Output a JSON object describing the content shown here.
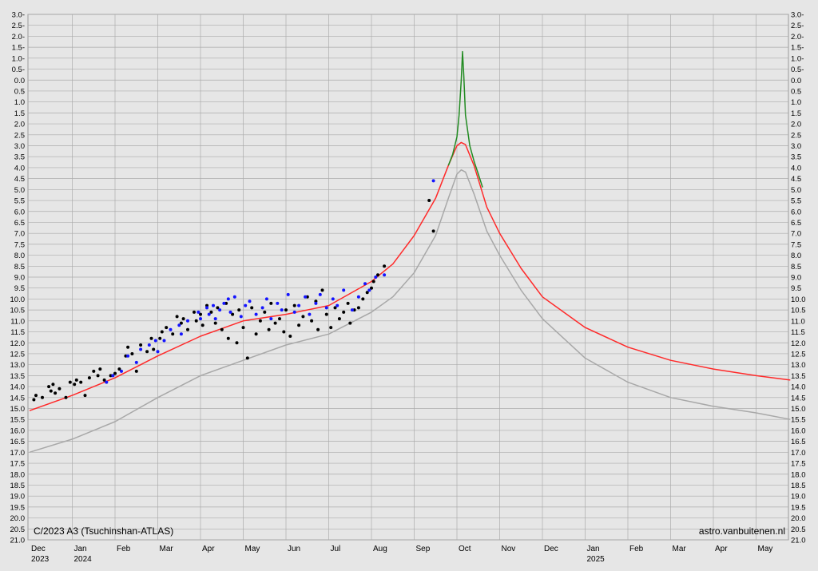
{
  "chart_data": {
    "type": "scatter",
    "title": "C/2023 A3 (Tsuchinshan-ATLAS)",
    "credit": "astro.vanbuitenen.nl",
    "x_axis": {
      "months": [
        "Dec",
        "Jan",
        "Feb",
        "Mar",
        "Apr",
        "May",
        "Jun",
        "Jul",
        "Aug",
        "Sep",
        "Oct",
        "Nov",
        "Dec",
        "Jan",
        "Feb",
        "Mar",
        "Apr",
        "May"
      ],
      "years": [
        {
          "label": "2023",
          "month_index": 0
        },
        {
          "label": "2024",
          "month_index": 1
        },
        {
          "label": "2025",
          "month_index": 13
        }
      ]
    },
    "y_axis": {
      "reversed": true,
      "ylim": [
        -3.0,
        21.0
      ],
      "tick_labels": [
        "3.0-",
        "2.5-",
        "2.0-",
        "1.5-",
        "1.0-",
        "0.5-",
        "0.0",
        "0.5",
        "1.0",
        "1.5",
        "2.0",
        "2.5",
        "3.0",
        "3.5",
        "4.0",
        "4.5",
        "5.0",
        "5.5",
        "6.0",
        "6.5",
        "7.0",
        "7.5",
        "8.0",
        "8.5",
        "9.0",
        "9.5",
        "10.0",
        "10.5",
        "11.0",
        "11.5",
        "12.0",
        "12.5",
        "13.0",
        "13.5",
        "14.0",
        "14.5",
        "15.0",
        "15.5",
        "16.0",
        "16.5",
        "17.0",
        "17.5",
        "18.0",
        "18.5",
        "19.0",
        "19.5",
        "20.0",
        "20.5",
        "21.0"
      ],
      "grid": true
    },
    "series": [
      {
        "kind": "line",
        "color": "#a8a8a8",
        "x": [
          0,
          1,
          2,
          3,
          4,
          5,
          6,
          7,
          8,
          8.5,
          9,
          9.5,
          9.8,
          10,
          10.1,
          10.2,
          10.4,
          10.7,
          11,
          11.5,
          12,
          13,
          14,
          15,
          16,
          17,
          17.8
        ],
        "y": [
          17.0,
          16.4,
          15.6,
          14.5,
          13.5,
          12.8,
          12.1,
          11.6,
          10.6,
          9.9,
          8.8,
          7.1,
          5.4,
          4.3,
          4.1,
          4.2,
          5.2,
          6.9,
          8.0,
          9.6,
          10.9,
          12.7,
          13.8,
          14.5,
          14.9,
          15.2,
          15.5
        ]
      },
      {
        "kind": "line",
        "color": "#ff2a2a",
        "x": [
          0,
          1,
          2,
          3,
          4,
          5,
          6,
          7,
          8,
          8.5,
          9,
          9.5,
          9.8,
          10,
          10.1,
          10.2,
          10.4,
          10.7,
          11,
          11.5,
          12,
          13,
          14,
          15,
          16,
          17,
          17.8
        ],
        "y": [
          15.1,
          14.4,
          13.6,
          12.6,
          11.7,
          11.0,
          10.7,
          10.3,
          9.2,
          8.4,
          7.1,
          5.4,
          3.9,
          3.0,
          2.85,
          2.95,
          3.9,
          5.8,
          7.0,
          8.6,
          9.9,
          11.3,
          12.2,
          12.8,
          13.2,
          13.5,
          13.7
        ]
      },
      {
        "kind": "line",
        "color": "#228b22",
        "x": [
          9.8,
          9.9,
          10.0,
          10.05,
          10.1,
          10.13,
          10.16,
          10.2,
          10.3,
          10.4,
          10.5,
          10.6
        ],
        "y": [
          3.9,
          3.4,
          2.6,
          1.6,
          0.0,
          -1.3,
          -0.2,
          1.6,
          3.0,
          3.7,
          4.3,
          4.9
        ]
      },
      {
        "kind": "points",
        "color": "#000000",
        "x": [
          0.1,
          0.15,
          0.3,
          0.45,
          0.5,
          0.55,
          0.6,
          0.7,
          0.85,
          0.95,
          1.05,
          1.1,
          1.2,
          1.3,
          1.4,
          1.5,
          1.6,
          1.65,
          1.75,
          1.9,
          2.0,
          2.1,
          2.25,
          2.3,
          2.4,
          2.5,
          2.6,
          2.75,
          2.85,
          2.9,
          3.05,
          3.1,
          3.2,
          3.35,
          3.45,
          3.55,
          3.6,
          3.7,
          3.85,
          3.9,
          4.0,
          4.05,
          4.15,
          4.25,
          4.35,
          4.4,
          4.5,
          4.6,
          4.65,
          4.75,
          4.85,
          4.9,
          5.0,
          5.1,
          5.2,
          5.3,
          5.4,
          5.5,
          5.6,
          5.65,
          5.75,
          5.85,
          5.95,
          6.0,
          6.1,
          6.2,
          6.3,
          6.4,
          6.5,
          6.6,
          6.7,
          6.75,
          6.85,
          6.95,
          7.05,
          7.15,
          7.25,
          7.35,
          7.45,
          7.5,
          7.6,
          7.7,
          7.8,
          7.9,
          8.0,
          8.05,
          8.15,
          8.3,
          9.35,
          9.45
        ],
        "y": [
          14.6,
          14.4,
          14.5,
          14.0,
          14.2,
          13.9,
          14.3,
          14.1,
          14.5,
          13.8,
          13.9,
          13.7,
          13.8,
          14.4,
          13.6,
          13.3,
          13.5,
          13.2,
          13.7,
          13.5,
          13.4,
          13.2,
          12.6,
          12.2,
          12.5,
          13.3,
          12.1,
          12.4,
          11.8,
          12.3,
          11.8,
          11.5,
          11.3,
          11.6,
          10.8,
          11.1,
          10.9,
          11.4,
          10.6,
          11.0,
          10.7,
          11.2,
          10.3,
          10.6,
          11.1,
          10.4,
          11.4,
          10.2,
          11.8,
          10.7,
          12.0,
          10.5,
          11.3,
          12.7,
          10.4,
          11.6,
          11.0,
          10.6,
          11.4,
          10.2,
          11.1,
          10.9,
          11.5,
          10.5,
          11.7,
          10.3,
          11.2,
          10.8,
          9.9,
          11.0,
          10.1,
          11.4,
          9.6,
          10.7,
          11.3,
          10.4,
          10.9,
          10.6,
          10.2,
          11.1,
          10.5,
          10.4,
          10.0,
          9.7,
          9.5,
          9.2,
          8.9,
          8.5,
          5.5,
          6.9
        ]
      },
      {
        "kind": "points",
        "color": "#1414ff",
        "x": [
          1.8,
          1.95,
          2.15,
          2.3,
          2.5,
          2.6,
          2.8,
          2.95,
          3.0,
          3.15,
          3.3,
          3.5,
          3.55,
          3.7,
          3.95,
          4.0,
          4.15,
          4.2,
          4.3,
          4.35,
          4.45,
          4.55,
          4.65,
          4.7,
          4.8,
          4.95,
          5.05,
          5.15,
          5.3,
          5.45,
          5.55,
          5.65,
          5.8,
          5.9,
          6.05,
          6.2,
          6.3,
          6.45,
          6.55,
          6.7,
          6.8,
          6.95,
          7.1,
          7.2,
          7.35,
          7.55,
          7.7,
          7.85,
          7.95,
          8.1,
          8.3,
          9.45
        ],
        "y": [
          13.8,
          13.5,
          13.3,
          12.6,
          12.9,
          12.3,
          12.1,
          11.9,
          12.4,
          11.9,
          11.4,
          11.2,
          11.6,
          11.0,
          10.6,
          10.9,
          10.4,
          10.7,
          10.3,
          10.9,
          10.5,
          10.2,
          10.0,
          10.6,
          9.9,
          10.8,
          10.3,
          10.1,
          10.7,
          10.4,
          10.0,
          10.9,
          10.2,
          10.5,
          9.8,
          10.6,
          10.3,
          9.9,
          10.7,
          10.2,
          9.8,
          10.4,
          10.0,
          10.3,
          9.6,
          10.5,
          9.9,
          9.3,
          9.6,
          9.0,
          8.9,
          4.6
        ]
      }
    ]
  }
}
